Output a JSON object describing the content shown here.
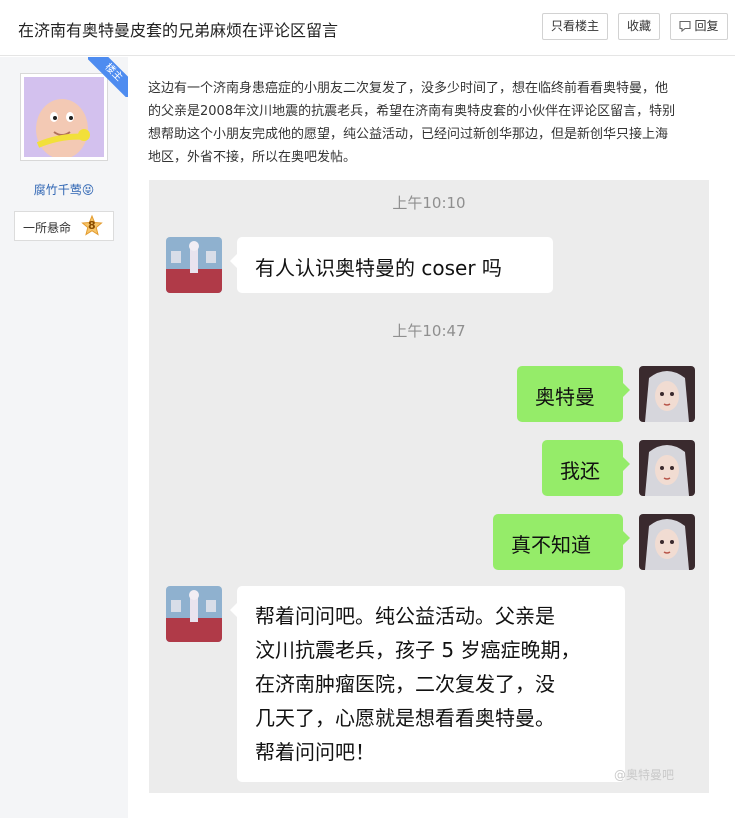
{
  "header": {
    "title": "在济南有奥特曼皮套的兄弟麻烦在评论区留言",
    "only_op_label": "只看楼主",
    "favorite_label": "收藏",
    "reply_label": "回复"
  },
  "sidebar": {
    "op_badge": "楼主",
    "username": "腐竹千莺😝",
    "level_name": "一所悬命",
    "level_number": "8"
  },
  "post": {
    "lines": [
      "这边有一个济南身患癌症的小朋友二次复发了，没多少时间了，想在临终前看看奥特曼，他",
      "的父亲是2008年汶川地震的抗震老兵，希望在济南有奥特皮套的小伙伴在评论区留言，特别",
      "想帮助这个小朋友完成他的愿望，纯公益活动，已经问过新创华那边，但是新创华只接上海",
      "地区，外省不接，所以在奥吧发帖。"
    ]
  },
  "chat": {
    "time1": "上午10:10",
    "msg1": "有人认识奥特曼的 coser 吗",
    "time2": "上午10:47",
    "msg2": "奥特曼",
    "msg3": "我还",
    "msg4": "真不知道",
    "msg5_lines": [
      "帮着问问吧。纯公益活动。父亲是",
      "汶川抗震老兵，孩子 5 岁癌症晚期，",
      "在济南肿瘤医院，二次复发了，没",
      "几天了，心愿就是想看看奥特曼。",
      "帮着问问吧！"
    ],
    "watermark": "@奥特曼吧"
  }
}
